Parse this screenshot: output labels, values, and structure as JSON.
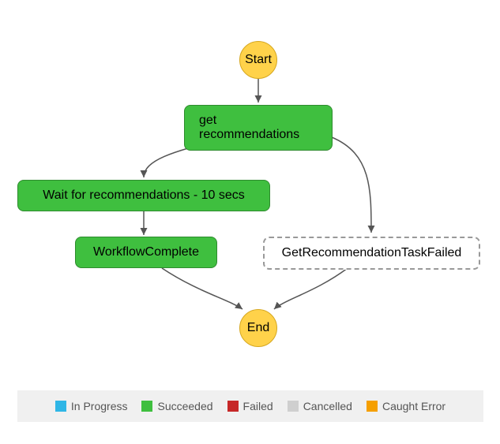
{
  "nodes": {
    "start": "Start",
    "get_rec": "get recommendations",
    "wait": "Wait for recommendations - 10 secs",
    "workflow_complete": "WorkflowComplete",
    "task_failed": "GetRecommendationTaskFailed",
    "end": "End"
  },
  "legend": {
    "in_progress": "In Progress",
    "succeeded": "Succeeded",
    "failed": "Failed",
    "cancelled": "Cancelled",
    "caught_error": "Caught Error"
  },
  "chart_data": {
    "type": "state-machine-flow",
    "states": [
      {
        "id": "start",
        "label": "Start",
        "kind": "terminal",
        "status": null
      },
      {
        "id": "get_rec",
        "label": "get recommendations",
        "kind": "task",
        "status": "Succeeded"
      },
      {
        "id": "wait",
        "label": "Wait for recommendations - 10 secs",
        "kind": "wait",
        "status": "Succeeded"
      },
      {
        "id": "workflow_complete",
        "label": "WorkflowComplete",
        "kind": "task",
        "status": "Succeeded"
      },
      {
        "id": "task_failed",
        "label": "GetRecommendationTaskFailed",
        "kind": "task",
        "status": "NotExecuted"
      },
      {
        "id": "end",
        "label": "End",
        "kind": "terminal",
        "status": null
      }
    ],
    "transitions": [
      {
        "from": "start",
        "to": "get_rec"
      },
      {
        "from": "get_rec",
        "to": "wait"
      },
      {
        "from": "get_rec",
        "to": "task_failed"
      },
      {
        "from": "wait",
        "to": "workflow_complete"
      },
      {
        "from": "workflow_complete",
        "to": "end"
      },
      {
        "from": "task_failed",
        "to": "end"
      }
    ],
    "legend_status_colors": {
      "In Progress": "#2fb6e6",
      "Succeeded": "#3fbf3f",
      "Failed": "#c62828",
      "Cancelled": "#cfcfcf",
      "Caught Error": "#f59f00"
    }
  }
}
